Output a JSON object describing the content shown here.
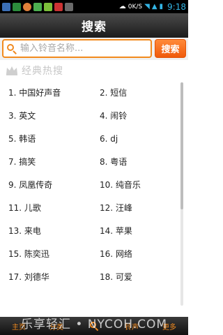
{
  "status_bar": {
    "network_label": "0K/S",
    "time": "9:18"
  },
  "header": {
    "title": "搜索"
  },
  "search": {
    "placeholder": "输入铃音名称...",
    "button_label": "搜索"
  },
  "section": {
    "title": "经典热搜"
  },
  "hot_list": [
    [
      "1. 中国好声音",
      "2. 短信"
    ],
    [
      "3. 英文",
      "4. 闹铃"
    ],
    [
      "5. 韩语",
      "6. dj"
    ],
    [
      "7. 搞笑",
      "8. 粤语"
    ],
    [
      "9. 凤凰传奇",
      "10. 纯音乐"
    ],
    [
      "11. 儿歌",
      "12. 汪峰"
    ],
    [
      "13. 来电",
      "14. 苹果"
    ],
    [
      "15. 陈奕迅",
      "16. 网络"
    ],
    [
      "17. 刘德华",
      "18. 可爱"
    ]
  ],
  "tabs": [
    "主页",
    "分类",
    "",
    "铃声",
    "更多"
  ],
  "watermark": "乐享轻汇 • NYCOH.COM",
  "colors": {
    "accent": "#f08a20",
    "search_button": "#f05a0a",
    "title_bar": "#2a2a2a"
  }
}
